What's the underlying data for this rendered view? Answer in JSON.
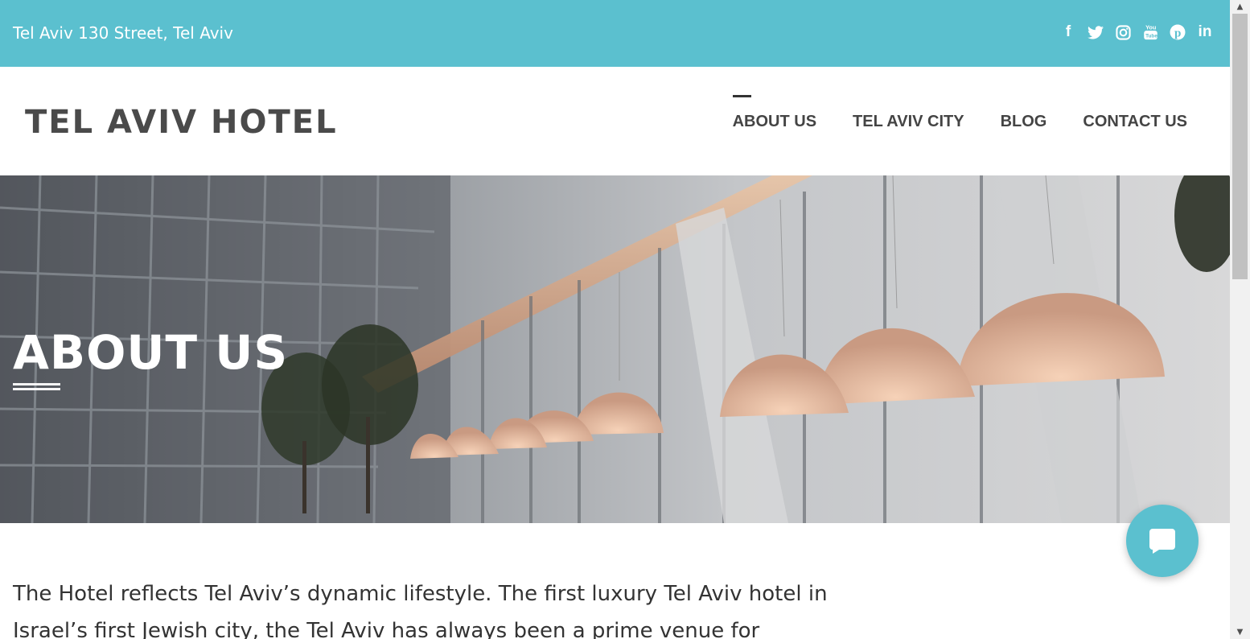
{
  "topbar": {
    "address": "Tel Aviv 130 Street, Tel Aviv",
    "bg_color": "#5bc0cf",
    "socials": [
      {
        "name": "facebook-icon",
        "glyph": "f"
      },
      {
        "name": "twitter-icon",
        "glyph": "🐦"
      },
      {
        "name": "instagram-icon",
        "glyph": "◎"
      },
      {
        "name": "youtube-icon",
        "glyph": "▶"
      },
      {
        "name": "pinterest-icon",
        "glyph": "℗"
      },
      {
        "name": "linkedin-icon",
        "glyph": "in"
      }
    ]
  },
  "header": {
    "logo": "TEL AVIV HOTEL",
    "nav": [
      {
        "label": "ABOUT US",
        "active": true
      },
      {
        "label": "TEL AVIV CITY",
        "active": false
      },
      {
        "label": "BLOG",
        "active": false
      },
      {
        "label": "CONTACT US",
        "active": false
      }
    ]
  },
  "hero": {
    "title": "ABOUT US"
  },
  "content": {
    "paragraph": "The Hotel reflects Tel Aviv’s dynamic lifestyle. The first luxury Tel Aviv hotel in Israel’s first Jewish city, the Tel Aviv has always been a prime venue for"
  },
  "chat": {
    "icon": "chat-bubble-icon"
  }
}
